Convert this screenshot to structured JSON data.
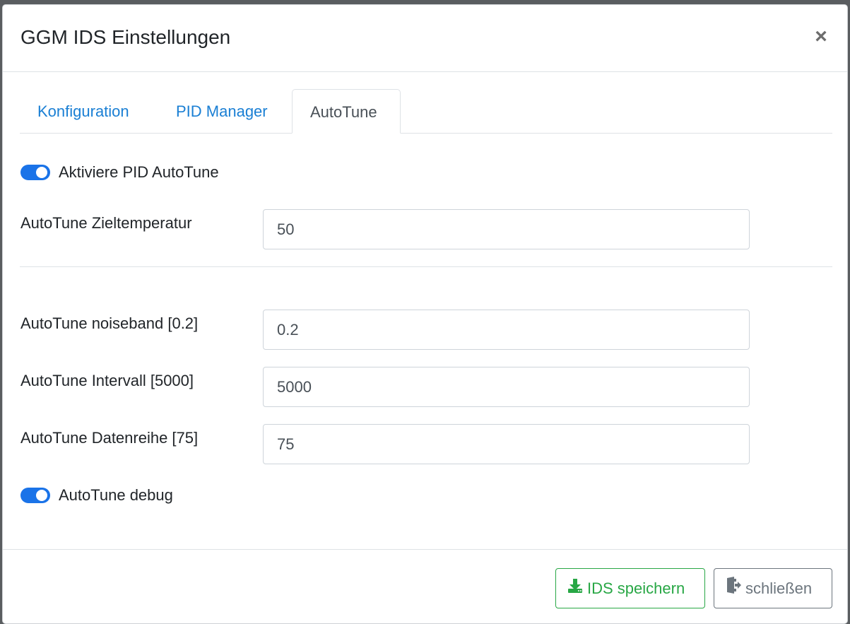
{
  "modal": {
    "title": "GGM IDS Einstellungen",
    "close_symbol": "×"
  },
  "tabs": [
    {
      "label": "Konfiguration",
      "active": false
    },
    {
      "label": "PID Manager",
      "active": false
    },
    {
      "label": "AutoTune",
      "active": true
    }
  ],
  "autotune": {
    "enable_switch": {
      "label": "Aktiviere PID AutoTune",
      "checked": true
    },
    "target_temp": {
      "label": "AutoTune Zieltemperatur",
      "value": "50"
    },
    "noiseband": {
      "label": "AutoTune noiseband [0.2]",
      "value": "0.2"
    },
    "interval": {
      "label": "AutoTune Intervall [5000]",
      "value": "5000"
    },
    "lookback": {
      "label": "AutoTune Datenreihe [75]",
      "value": "75"
    },
    "debug_switch": {
      "label": "AutoTune debug",
      "checked": true
    }
  },
  "footer": {
    "save_label": "IDS speichern",
    "save_icon": "download-icon",
    "close_label": "schließen",
    "close_icon": "sign-out-icon"
  },
  "colors": {
    "accent": "#1a73e8",
    "link": "#1a7fd4",
    "success": "#28a745",
    "secondary": "#6c757d"
  }
}
